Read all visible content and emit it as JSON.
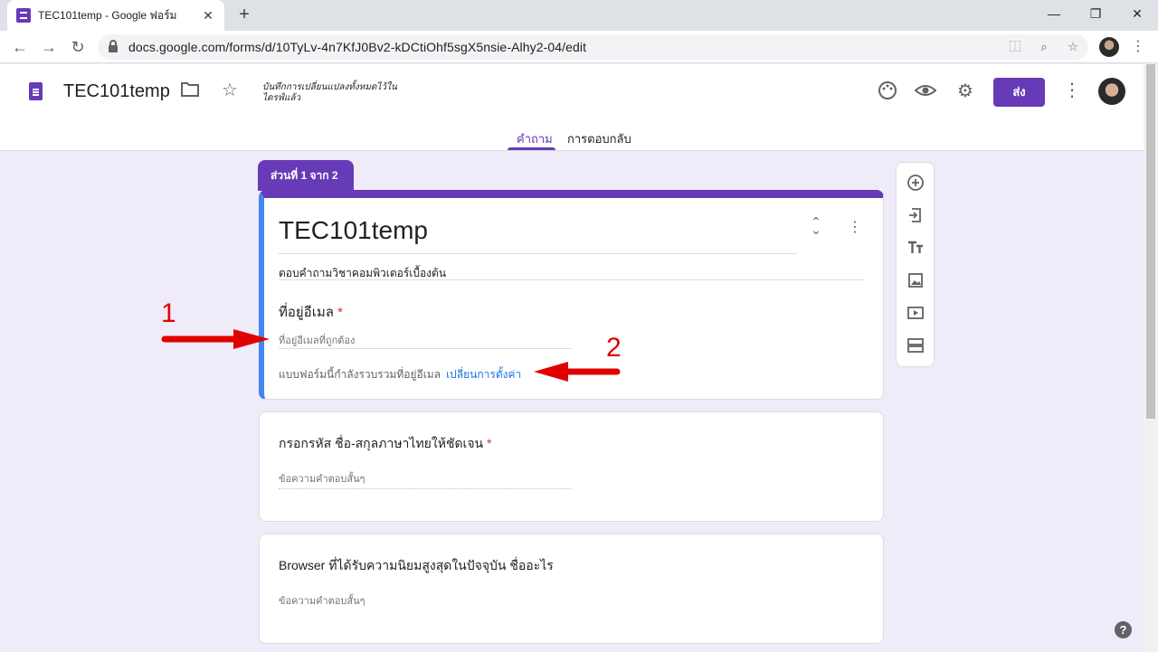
{
  "browser": {
    "tab_title": "TEC101temp - Google ฟอร์ม",
    "new_tab_icon": "plus-icon",
    "url": "docs.google.com/forms/d/10TyLv-4n7KfJ0Bv2-kDCtiOhf5sgX5nsie-Alhy2-04/edit",
    "window_controls": [
      "minimize",
      "restore",
      "close"
    ]
  },
  "header": {
    "title": "TEC101temp",
    "save_status": "บันทึกการเปลี่ยนแปลงทั้งหมดไว้ในไดรฟ์แล้ว",
    "send_label": "ส่ง",
    "icons": [
      "palette-icon",
      "eye-icon",
      "gear-icon",
      "more-vert-icon"
    ]
  },
  "tabs": {
    "questions": "คำถาม",
    "responses": "การตอบกลับ"
  },
  "section": {
    "label": "ส่วนที่ 1 จาก 2"
  },
  "form": {
    "title": "TEC101temp",
    "description": "ตอบคำถามวิชาคอมพิวเตอร์เบื้องต้น",
    "email_label": "ที่อยู่อีเมล",
    "required_mark": "*",
    "email_placeholder": "ที่อยู่อีเมลที่ถูกต้อง",
    "collect_note": "แบบฟอร์มนี้กำลังรวบรวมที่อยู่อีเมล",
    "change_settings_link": "เปลี่ยนการตั้งค่า"
  },
  "questions": [
    {
      "title": "กรอกรหัส ชื่อ-สกุลภาษาไทยให้ชัดเจน",
      "required": "*",
      "answer_placeholder": "ข้อความคำตอบสั้นๆ"
    },
    {
      "title": "Browser ที่ได้รับความนิยมสูงสุดในปัจจุบัน ชื่ออะไร",
      "required": "",
      "answer_placeholder": "ข้อความคำตอบสั้นๆ"
    }
  ],
  "side_toolbar": [
    "add-question-icon",
    "import-questions-icon",
    "add-title-icon",
    "add-image-icon",
    "add-video-icon",
    "add-section-icon"
  ],
  "annotations": {
    "label_1": "1",
    "label_2": "2",
    "color": "#e00000"
  },
  "colors": {
    "accent": "#673ab7",
    "focus": "#4285f4",
    "background": "#f0ebf8",
    "link": "#1a73e8"
  }
}
